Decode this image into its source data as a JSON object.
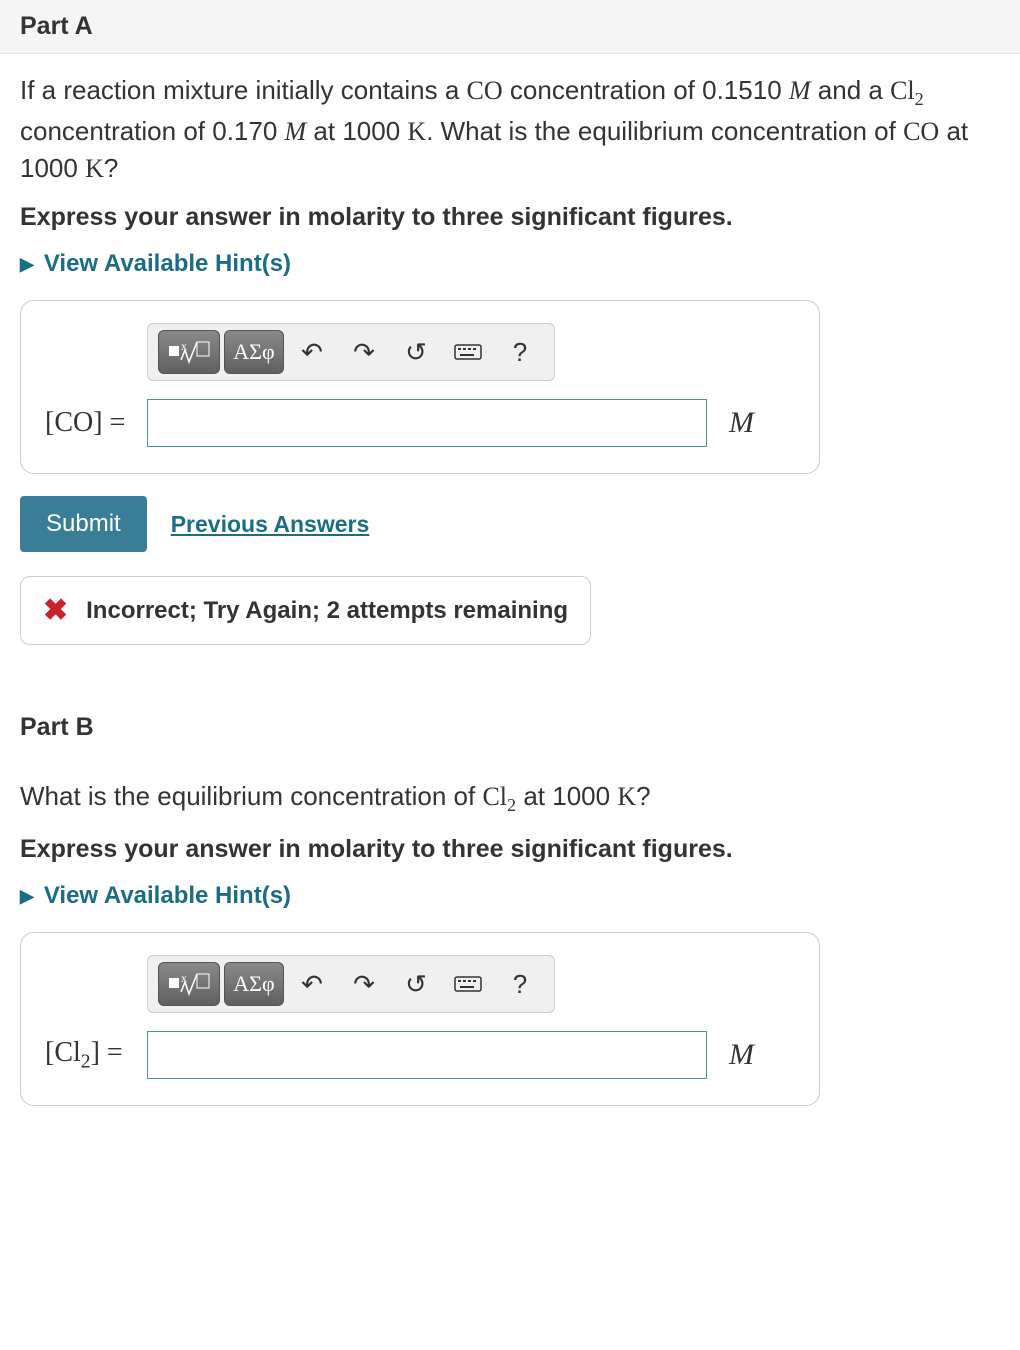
{
  "partA": {
    "title": "Part A",
    "question_prefix": "If a reaction mixture initially contains a ",
    "sp1": "CO",
    "mid1": " concentration of 0.1510 ",
    "M1": "M",
    "mid2": "  and a ",
    "sp2a": "Cl",
    "sp2b": "2",
    "mid3": " concentration of 0.170 ",
    "M2": "M",
    "mid4": " at 1000 ",
    "K1": "K",
    "mid5": ".  What is the equilibrium concentration of ",
    "sp3": "CO",
    "mid6": " at 1000 ",
    "K2": "K",
    "qmark": "?",
    "instruction": "Express your answer in molarity to three significant figures.",
    "hints_label": "View Available Hint(s)",
    "toolbar": {
      "templates_label": "ΑΣφ",
      "help_label": "?"
    },
    "label_open": "[",
    "label_sp": "CO",
    "label_close": "] = ",
    "unit": "M",
    "submit_label": "Submit",
    "prev_answers_label": "Previous Answers",
    "feedback_text": "Incorrect; Try Again; 2 attempts remaining"
  },
  "partB": {
    "title": "Part B",
    "q_prefix": "What is the equilibrium concentration of ",
    "sp1a": "Cl",
    "sp1b": "2",
    "mid1": " at 1000 ",
    "K1": "K",
    "qmark": "?",
    "instruction": "Express your answer in molarity to three significant figures.",
    "hints_label": "View Available Hint(s)",
    "toolbar": {
      "templates_label": "ΑΣφ",
      "help_label": "?"
    },
    "label_open": "[",
    "label_sp_a": "Cl",
    "label_sp_b": "2",
    "label_close": "] = ",
    "unit": "M"
  }
}
